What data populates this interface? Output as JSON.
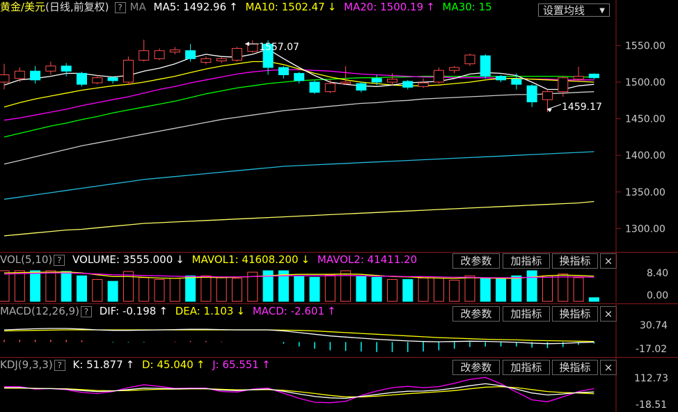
{
  "colors": {
    "bg": "#000000",
    "up": "#ff4d4d",
    "down": "#00ffff",
    "ma5": "#ffffff",
    "ma10": "#ffff00",
    "ma20": "#ff00ff",
    "ma30": "#00ff00",
    "ma60": "#cccccc",
    "ma120": "#22bbdd",
    "ma250": "#ffff66",
    "grid": "#8a1a1a"
  },
  "main": {
    "title": "黄金/美元",
    "period": "(日线,前复权)",
    "q": "?",
    "ma_label": "MA",
    "ma5": "MA5: 1492.96",
    "ma5_arrow": "↑",
    "ma10": "MA10: 1502.47",
    "ma10_arrow": "↓",
    "ma20": "MA20: 1500.19",
    "ma20_arrow": "↑",
    "ma30": "MA30: 15",
    "settings_label": "设置均线",
    "settings_icon": "caret-down-icon",
    "high_label": "1557.07",
    "low_label": "1459.17",
    "axis": [
      "1550.00",
      "1500.00",
      "1450.00",
      "1400.00",
      "1350.00",
      "1300.00"
    ]
  },
  "vol": {
    "name": "VOL(5,10)",
    "q": "?",
    "volume": "VOLUME: 3555.000",
    "volume_arrow": "↓",
    "mavol1": "MAVOL1: 41608.200",
    "mavol1_arrow": "↓",
    "mavol2": "MAVOL2: 41411.20",
    "axis": [
      "8.40",
      "0.00"
    ]
  },
  "macd": {
    "name": "MACD(12,26,9)",
    "q": "?",
    "dif": "DIF: -0.198",
    "dif_arrow": "↑",
    "dea": "DEA: 1.103",
    "dea_arrow": "↓",
    "macd": "MACD: -2.601",
    "macd_arrow": "↑",
    "axis": [
      "30.74",
      "-17.02"
    ]
  },
  "kdj": {
    "name": "KDJ(9,3,3)",
    "q": "?",
    "k": "K: 51.877",
    "k_arrow": "↑",
    "d": "D: 45.040",
    "d_arrow": "↑",
    "j": "J: 65.551",
    "j_arrow": "↑",
    "axis": [
      "112.73",
      "-18.51"
    ]
  },
  "buttons": {
    "params": "改参数",
    "add": "加指标",
    "switch": "换指标",
    "close": "×"
  },
  "chart_data": {
    "type": "candlestick",
    "title": "黄金/美元",
    "ylim": [
      1290,
      1565
    ],
    "candles": [
      {
        "o": 1500,
        "c": 1510,
        "h": 1525,
        "l": 1490
      },
      {
        "o": 1505,
        "c": 1515,
        "h": 1520,
        "l": 1500
      },
      {
        "o": 1515,
        "c": 1503,
        "h": 1522,
        "l": 1498
      },
      {
        "o": 1515,
        "c": 1522,
        "h": 1528,
        "l": 1510
      },
      {
        "o": 1522,
        "c": 1515,
        "h": 1526,
        "l": 1508
      },
      {
        "o": 1512,
        "c": 1497,
        "h": 1514,
        "l": 1494
      },
      {
        "o": 1499,
        "c": 1506,
        "h": 1510,
        "l": 1497
      },
      {
        "o": 1506,
        "c": 1502,
        "h": 1508,
        "l": 1498
      },
      {
        "o": 1500,
        "c": 1530,
        "h": 1535,
        "l": 1496
      },
      {
        "o": 1530,
        "c": 1543,
        "h": 1558,
        "l": 1528
      },
      {
        "o": 1532,
        "c": 1543,
        "h": 1546,
        "l": 1530
      },
      {
        "o": 1541,
        "c": 1544,
        "h": 1548,
        "l": 1538
      },
      {
        "o": 1543,
        "c": 1532,
        "h": 1552,
        "l": 1528
      },
      {
        "o": 1527,
        "c": 1532,
        "h": 1535,
        "l": 1524
      },
      {
        "o": 1529,
        "c": 1532,
        "h": 1534,
        "l": 1526
      },
      {
        "o": 1530,
        "c": 1546,
        "h": 1548,
        "l": 1528
      },
      {
        "o": 1542,
        "c": 1552,
        "h": 1557,
        "l": 1540
      },
      {
        "o": 1552,
        "c": 1520,
        "h": 1557,
        "l": 1510
      },
      {
        "o": 1520,
        "c": 1510,
        "h": 1522,
        "l": 1505
      },
      {
        "o": 1512,
        "c": 1502,
        "h": 1514,
        "l": 1498
      },
      {
        "o": 1500,
        "c": 1486,
        "h": 1502,
        "l": 1484
      },
      {
        "o": 1487,
        "c": 1498,
        "h": 1504,
        "l": 1485
      },
      {
        "o": 1498,
        "c": 1500,
        "h": 1522,
        "l": 1496
      },
      {
        "o": 1498,
        "c": 1489,
        "h": 1500,
        "l": 1486
      },
      {
        "o": 1505,
        "c": 1500,
        "h": 1510,
        "l": 1496
      },
      {
        "o": 1500,
        "c": 1504,
        "h": 1512,
        "l": 1496
      },
      {
        "o": 1501,
        "c": 1493,
        "h": 1503,
        "l": 1490
      },
      {
        "o": 1494,
        "c": 1499,
        "h": 1505,
        "l": 1492
      },
      {
        "o": 1500,
        "c": 1516,
        "h": 1520,
        "l": 1498
      },
      {
        "o": 1516,
        "c": 1520,
        "h": 1522,
        "l": 1512
      },
      {
        "o": 1525,
        "c": 1537,
        "h": 1539,
        "l": 1522
      },
      {
        "o": 1536,
        "c": 1508,
        "h": 1538,
        "l": 1505
      },
      {
        "o": 1508,
        "c": 1503,
        "h": 1510,
        "l": 1500
      },
      {
        "o": 1504,
        "c": 1497,
        "h": 1512,
        "l": 1490
      },
      {
        "o": 1495,
        "c": 1473,
        "h": 1497,
        "l": 1466
      },
      {
        "o": 1476,
        "c": 1487,
        "h": 1490,
        "l": 1459
      },
      {
        "o": 1487,
        "c": 1506,
        "h": 1508,
        "l": 1480
      },
      {
        "o": 1504,
        "c": 1508,
        "h": 1521,
        "l": 1500
      },
      {
        "o": 1511,
        "c": 1506,
        "h": 1512,
        "l": 1504
      }
    ],
    "ma5": [
      1496,
      1503,
      1505,
      1508,
      1512,
      1512,
      1509,
      1507,
      1509,
      1515,
      1519,
      1525,
      1533,
      1538,
      1535,
      1534,
      1538,
      1545,
      1532,
      1520,
      1509,
      1500,
      1497,
      1495,
      1494,
      1496,
      1499,
      1500,
      1501,
      1505,
      1511,
      1513,
      1512,
      1509,
      1500,
      1490,
      1490,
      1495,
      1497
    ],
    "ma10": [
      1466,
      1472,
      1477,
      1481,
      1485,
      1489,
      1492,
      1495,
      1497,
      1500,
      1504,
      1508,
      1513,
      1518,
      1522,
      1525,
      1528,
      1528,
      1524,
      1518,
      1512,
      1507,
      1503,
      1500,
      1498,
      1496,
      1495,
      1495,
      1496,
      1498,
      1500,
      1503,
      1505,
      1505,
      1504,
      1503,
      1502,
      1501,
      1500
    ],
    "ma20": [
      1448,
      1451,
      1455,
      1459,
      1463,
      1468,
      1472,
      1476,
      1480,
      1485,
      1490,
      1494,
      1499,
      1503,
      1507,
      1511,
      1514,
      1516,
      1517,
      1517,
      1516,
      1515,
      1513,
      1511,
      1510,
      1509,
      1508,
      1507,
      1507,
      1506,
      1506,
      1506,
      1505,
      1505,
      1504,
      1504,
      1503,
      1503,
      1503
    ],
    "ma30": [
      1425,
      1430,
      1435,
      1440,
      1444,
      1449,
      1453,
      1458,
      1462,
      1466,
      1470,
      1474,
      1479,
      1484,
      1488,
      1492,
      1495,
      1498,
      1500,
      1502,
      1503,
      1504,
      1505,
      1506,
      1506,
      1507,
      1507,
      1508,
      1508,
      1508,
      1508,
      1508,
      1508,
      1508,
      1508,
      1508,
      1508,
      1507,
      1507
    ],
    "ma60": [
      1388,
      1393,
      1398,
      1403,
      1408,
      1413,
      1417,
      1421,
      1425,
      1429,
      1433,
      1437,
      1441,
      1445,
      1449,
      1452,
      1455,
      1458,
      1461,
      1463,
      1465,
      1467,
      1469,
      1471,
      1472,
      1474,
      1475,
      1477,
      1478,
      1479,
      1480,
      1481,
      1482,
      1483,
      1483,
      1484,
      1485,
      1486,
      1487
    ],
    "ma120": [
      1340,
      1343,
      1346,
      1349,
      1352,
      1355,
      1358,
      1361,
      1364,
      1367,
      1369,
      1371,
      1373,
      1375,
      1377,
      1379,
      1381,
      1383,
      1385,
      1386,
      1387,
      1388,
      1389,
      1390,
      1391,
      1392,
      1393,
      1394,
      1395,
      1396,
      1397,
      1398,
      1399,
      1400,
      1401,
      1402,
      1403,
      1404,
      1405
    ],
    "ma250": [
      1290,
      1292,
      1294,
      1296,
      1298,
      1299,
      1301,
      1303,
      1305,
      1307,
      1308,
      1309,
      1310,
      1311,
      1312,
      1313,
      1314,
      1315,
      1316,
      1317,
      1318,
      1319,
      1320,
      1321,
      1322,
      1323,
      1324,
      1325,
      1326,
      1327,
      1328,
      1329,
      1330,
      1331,
      1332,
      1333,
      1334,
      1335,
      1337
    ],
    "volume": [
      8.4,
      8.4,
      8.4,
      8.4,
      8.2,
      7.0,
      6.0,
      5.5,
      8.2,
      6.5,
      6.0,
      6.3,
      7.0,
      7.0,
      6.5,
      6.3,
      8.0,
      8.4,
      8.4,
      7.0,
      6.6,
      7.2,
      8.4,
      6.8,
      6.6,
      6.0,
      6.0,
      6.4,
      6.4,
      5.8,
      7.0,
      6.5,
      6.1,
      7.0,
      8.4,
      7.0,
      7.5,
      6.5,
      1.0
    ],
    "vol_ylim": [
      0,
      8.4
    ],
    "mavol1": [
      7.8,
      7.9,
      8.0,
      8.0,
      8.1,
      7.8,
      7.3,
      6.8,
      6.8,
      6.6,
      6.4,
      6.3,
      6.5,
      6.6,
      6.5,
      6.6,
      6.8,
      7.0,
      7.3,
      7.4,
      7.4,
      7.4,
      7.5,
      7.4,
      7.1,
      6.8,
      6.7,
      6.5,
      6.4,
      6.3,
      6.5,
      6.4,
      6.3,
      6.3,
      6.7,
      7.0,
      7.2,
      7.1,
      6.9
    ],
    "mavol2": [
      7.5,
      7.6,
      7.7,
      7.8,
      7.8,
      7.7,
      7.5,
      7.3,
      7.2,
      7.1,
      7.0,
      6.9,
      6.8,
      6.8,
      6.7,
      6.7,
      6.8,
      6.9,
      7.0,
      7.0,
      7.0,
      7.0,
      7.1,
      7.0,
      6.9,
      6.9,
      6.8,
      6.8,
      6.7,
      6.6,
      6.6,
      6.5,
      6.5,
      6.5,
      6.6,
      6.6,
      6.7,
      6.7,
      6.6
    ],
    "macd_ylim": [
      -17.02,
      30.74
    ],
    "dif": [
      22,
      23,
      24,
      24.5,
      24.5,
      23.5,
      22,
      21,
      21,
      21.5,
      22,
      22.5,
      23,
      23,
      22.5,
      22,
      22,
      22,
      20,
      17,
      14,
      11,
      9,
      7,
      5,
      3.5,
      2,
      1,
      0.5,
      1,
      1.5,
      1.2,
      0.5,
      -0.5,
      -2,
      -3,
      -2.5,
      -1,
      -0.2
    ],
    "dea": [
      20,
      20.5,
      21,
      21.5,
      22,
      22,
      22,
      22,
      22,
      22,
      22,
      22,
      22,
      22,
      22,
      22,
      22,
      22,
      21.5,
      21,
      20,
      18.5,
      17,
      15.5,
      14,
      12.5,
      11,
      9.5,
      8,
      7,
      6,
      5,
      4.5,
      3.8,
      3,
      2.5,
      2,
      1.5,
      1.1
    ],
    "macd_hist": [
      4,
      4,
      4,
      4,
      4,
      3,
      0,
      -1,
      -1,
      -1,
      0,
      1,
      2,
      2,
      1,
      0,
      0,
      0,
      -3,
      -8,
      -12,
      -15,
      -16,
      -17,
      -18,
      -18,
      -18,
      -17,
      -15,
      -12,
      -9,
      -8,
      -8,
      -8,
      -10,
      -11,
      -9,
      -5,
      -2.6
    ],
    "kdj_ylim": [
      -18.51,
      112.73
    ],
    "k": [
      70,
      70,
      66,
      66,
      64,
      58,
      54,
      56,
      62,
      68,
      67,
      65,
      66,
      66,
      60,
      58,
      62,
      64,
      55,
      44,
      34,
      28,
      26,
      34,
      42,
      50,
      55,
      56,
      60,
      68,
      78,
      86,
      78,
      64,
      48,
      40,
      44,
      50,
      52
    ],
    "d": [
      68,
      68,
      67,
      66,
      65,
      62,
      58,
      57,
      58,
      61,
      63,
      64,
      65,
      65,
      63,
      61,
      61,
      62,
      59,
      53,
      46,
      38,
      32,
      32,
      35,
      40,
      45,
      49,
      53,
      58,
      65,
      72,
      74,
      70,
      62,
      54,
      50,
      48,
      45
    ],
    "j": [
      74,
      74,
      64,
      66,
      62,
      50,
      46,
      54,
      70,
      82,
      75,
      67,
      68,
      68,
      54,
      52,
      64,
      68,
      47,
      26,
      10,
      8,
      14,
      38,
      56,
      70,
      75,
      70,
      74,
      88,
      104,
      112,
      86,
      52,
      20,
      12,
      32,
      54,
      66
    ]
  }
}
